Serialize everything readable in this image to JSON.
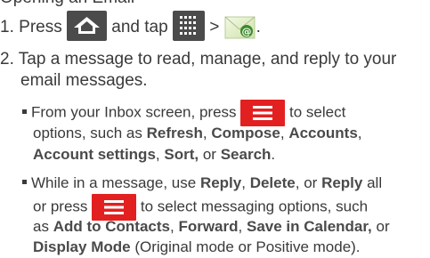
{
  "heading_fragment": "Opening an Email",
  "step1": {
    "num": "1.",
    "press": "Press",
    "and_tap": "and tap",
    "gt": ">",
    "period": "."
  },
  "step2": {
    "num": "2.",
    "line1": "Tap a message to read, manage, and reply to your",
    "line2": "email messages."
  },
  "bullet1": {
    "from": "From your Inbox screen, press",
    "to_select": "to select",
    "options_such_as": "options, such as",
    "refresh": "Refresh",
    "compose": "Compose",
    "accounts": "Accounts",
    "account_settings": "Account settings",
    "sort": "Sort,",
    "or": "or",
    "search": "Search",
    "comma": ",",
    "period": "."
  },
  "bullet2": {
    "while": "While in a message, use",
    "reply": "Reply",
    "delete": "Delete",
    "or": "or",
    "reply2": "Reply",
    "all": "all",
    "or_press": "or press",
    "to_select_msg": "to select messaging options, such",
    "as": "as",
    "add_contacts": "Add to Contacts",
    "forward": "Forward",
    "save_calendar": "Save in Calendar,",
    "display_mode": "Display Mode",
    "paren": "(Original mode or Positive mode).",
    "comma": ","
  },
  "icons": {
    "home": "home-key-icon",
    "apps": "apps-grid-icon",
    "email": "email-app-icon",
    "menu": "menu-key-icon"
  },
  "colors": {
    "key_gray": "#4b4b4b",
    "key_red": "#e32020",
    "text": "#3a3a3a"
  }
}
